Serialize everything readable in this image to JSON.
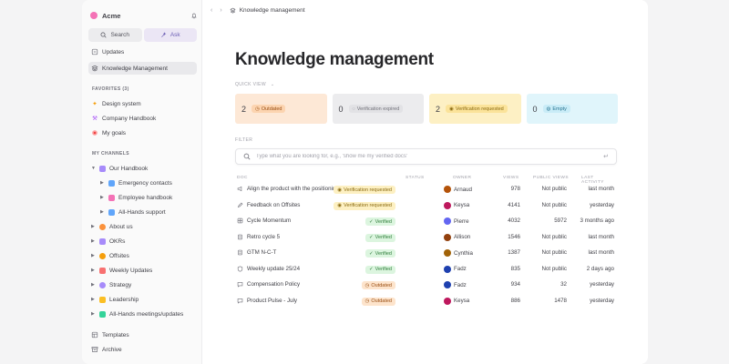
{
  "workspace": {
    "name": "Acme"
  },
  "sidebar": {
    "search_label": "Search",
    "ask_label": "Ask",
    "updates_label": "Updates",
    "km_label": "Knowledge Management",
    "favorites_header": "FAVORITES (3)",
    "favorites": [
      {
        "label": "Design system",
        "icon": "sparkle-icon"
      },
      {
        "label": "Company Handbook",
        "icon": "wrench-icon"
      },
      {
        "label": "My goals",
        "icon": "target-icon"
      }
    ],
    "channels_header": "MY CHANNELS",
    "channels": [
      {
        "label": "Our Handbook",
        "color": "#a78bfa"
      },
      {
        "label": "Emergency contacts",
        "color": "#60a5fa"
      },
      {
        "label": "Employee handbook",
        "color": "#f472b6"
      },
      {
        "label": "All-Hands support",
        "color": "#60a5fa"
      },
      {
        "label": "About us",
        "color": "#fb923c"
      },
      {
        "label": "OKRs",
        "color": "#a78bfa"
      },
      {
        "label": "Offsites",
        "color": "#f59e0b"
      },
      {
        "label": "Weekly Updates",
        "color": "#f87171"
      },
      {
        "label": "Strategy",
        "color": "#a78bfa"
      },
      {
        "label": "Leadership",
        "color": "#fbbf24"
      },
      {
        "label": "All-Hands meetings/updates",
        "color": "#34d399"
      }
    ],
    "templates_label": "Templates",
    "archive_label": "Archive"
  },
  "breadcrumb": {
    "label": "Knowledge management"
  },
  "page": {
    "title": "Knowledge management",
    "quick_view_label": "QUICK VIEW",
    "filter_label": "FILTER"
  },
  "quick_view": [
    {
      "count": "2",
      "label": "Outdated",
      "bg": "#fde8d6",
      "chip_bg": "#fcd4b0",
      "chip_color": "#9a4e12"
    },
    {
      "count": "0",
      "label": "Verification expired",
      "bg": "#ececee",
      "chip_bg": "#e2e2e5",
      "chip_color": "#71717a"
    },
    {
      "count": "2",
      "label": "Verification requested",
      "bg": "#fdf0c4",
      "chip_bg": "#fbe39a",
      "chip_color": "#8a6a10"
    },
    {
      "count": "0",
      "label": "Empty",
      "bg": "#e0f5fb",
      "chip_bg": "#c9ecf7",
      "chip_color": "#2b7793"
    }
  ],
  "search": {
    "placeholder": "Type what you are looking for, e.g., 'show me my verified docs'"
  },
  "table": {
    "columns": [
      "DOC",
      "STATUS",
      "OWNER",
      "VIEWS",
      "PUBLIC VIEWS",
      "LAST ACTIVITY"
    ],
    "rows": [
      {
        "doc": "Align the product with the positioning",
        "icon": "megaphone-icon",
        "status": "Verification requested",
        "status_type": "req",
        "owner": "Arnaud",
        "avatar": "#b45309",
        "views": "978",
        "public": "Not public",
        "last": "last month"
      },
      {
        "doc": "Feedback on Offsites",
        "icon": "pencil-icon",
        "status": "Verification requested",
        "status_type": "req",
        "owner": "Keysa",
        "avatar": "#be185d",
        "views": "4141",
        "public": "Not public",
        "last": "yesterday"
      },
      {
        "doc": "Cycle Momentum",
        "icon": "grid-icon",
        "status": "Verified",
        "status_type": "ver",
        "owner": "Pierre",
        "avatar": "#6366f1",
        "views": "4032",
        "public": "5972",
        "last": "3 months ago"
      },
      {
        "doc": "Retro cycle 5",
        "icon": "doc-icon",
        "status": "Verified",
        "status_type": "ver",
        "owner": "Allison",
        "avatar": "#92400e",
        "views": "1546",
        "public": "Not public",
        "last": "last month"
      },
      {
        "doc": "GTM N-C-T",
        "icon": "doc-icon",
        "status": "Verified",
        "status_type": "ver",
        "owner": "Cynthia",
        "avatar": "#a16207",
        "views": "1387",
        "public": "Not public",
        "last": "last month"
      },
      {
        "doc": "Weekly update 25/24",
        "icon": "shield-icon",
        "status": "Verified",
        "status_type": "ver",
        "owner": "Fadz",
        "avatar": "#1e40af",
        "views": "835",
        "public": "Not public",
        "last": "2 days ago"
      },
      {
        "doc": "Compensation Policy",
        "icon": "chat-icon",
        "status": "Outdated",
        "status_type": "out",
        "owner": "Fadz",
        "avatar": "#1e40af",
        "views": "934",
        "public": "32",
        "last": "yesterday"
      },
      {
        "doc": "Product Pulse - July",
        "icon": "chat-icon",
        "status": "Outdated",
        "status_type": "out",
        "owner": "Keysa",
        "avatar": "#be185d",
        "views": "886",
        "public": "1478",
        "last": "yesterday"
      }
    ]
  }
}
